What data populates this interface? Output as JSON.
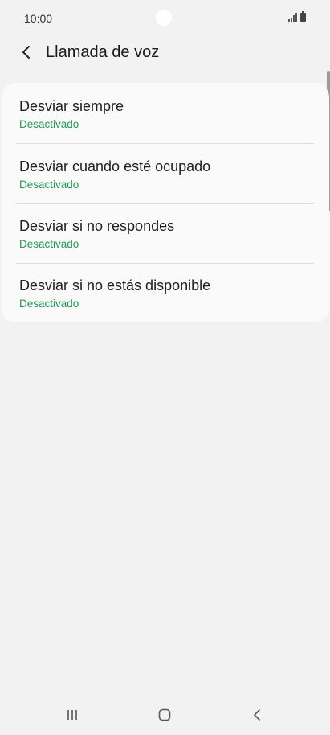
{
  "status_bar": {
    "time": "10:00"
  },
  "header": {
    "title": "Llamada de voz",
    "back_icon": "chevron-left-icon"
  },
  "forwarding_options": [
    {
      "title": "Desviar siempre",
      "status": "Desactivado"
    },
    {
      "title": "Desviar cuando esté ocupado",
      "status": "Desactivado"
    },
    {
      "title": "Desviar si no respondes",
      "status": "Desactivado"
    },
    {
      "title": "Desviar si no estás disponible",
      "status": "Desactivado"
    }
  ],
  "nav_bar": {
    "recents_icon": "recent-apps-icon",
    "home_icon": "home-icon",
    "back_icon": "back-icon"
  },
  "colors": {
    "background": "#f2f2f2",
    "card": "#fafafa",
    "status_accent": "#1a9c55",
    "text_primary": "#202020"
  }
}
